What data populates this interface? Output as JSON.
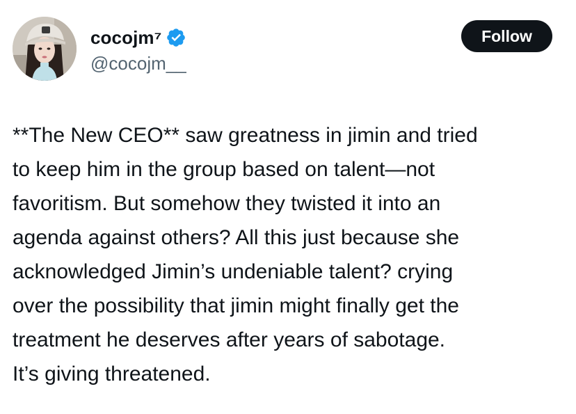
{
  "tweet": {
    "author": {
      "display_name": "cocojm⁷",
      "handle": "@cocojm__",
      "verified": true,
      "avatar_icon": "profile-photo"
    },
    "follow_label": "Follow",
    "text": "**The New CEO** saw greatness in jimin and tried\nto keep him in the group based on talent—not\nfavoritism. But somehow they twisted it into an\nagenda against others? All this just because she\nacknowledged Jimin’s undeniable talent? crying\nover the possibility that jimin might finally get the\ntreatment he deserves after years of sabotage.\nIt’s giving threatened."
  },
  "colors": {
    "text_primary": "#0f1419",
    "text_secondary": "#536471",
    "verified_blue": "#1d9bf0",
    "button_bg": "#0f1419",
    "button_text": "#ffffff",
    "background": "#ffffff"
  }
}
